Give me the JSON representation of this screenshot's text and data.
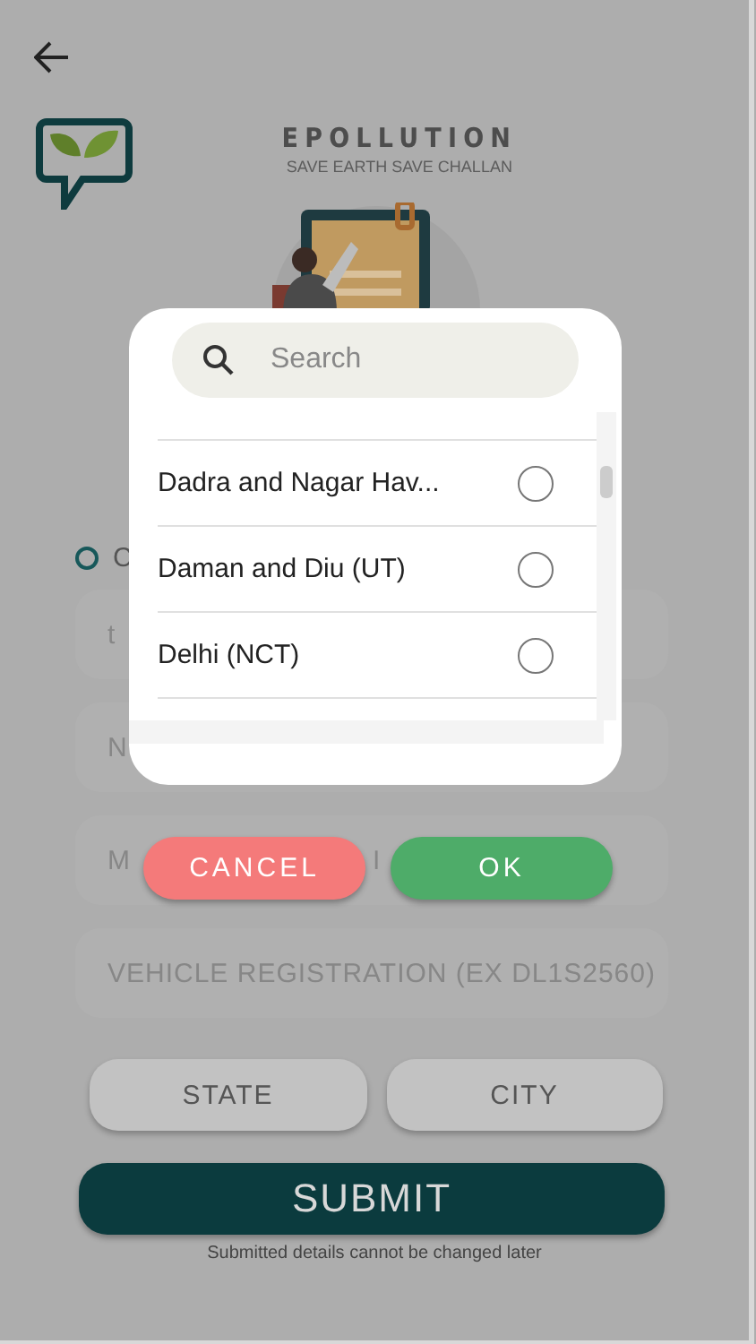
{
  "header": {
    "title": "EPOLLUTION",
    "subtitle": "SAVE EARTH SAVE CHALLAN"
  },
  "form": {
    "option_label": "C",
    "option_selected": false,
    "fields": [
      {
        "parts": [
          "t"
        ]
      },
      {
        "parts": [
          "N"
        ]
      },
      {
        "parts": [
          "M",
          "I"
        ]
      },
      {
        "parts": [
          "VEHICLE REGISTRATION (EX DL1S2560)"
        ]
      }
    ],
    "pickers": [
      "STATE",
      "CITY"
    ],
    "submit": "SUBMIT",
    "note": "Submitted details cannot be changed later"
  },
  "dialog": {
    "search": {
      "placeholder": "Search"
    },
    "items": [
      {
        "label": "Dadra and Nagar Hav...",
        "selected": false
      },
      {
        "label": "Daman and Diu (UT)",
        "selected": false
      },
      {
        "label": "Delhi (NCT)",
        "selected": false
      }
    ],
    "buttons": [
      {
        "label": "CANCEL",
        "kind": "cancel"
      },
      {
        "label": "OK",
        "kind": "ok"
      }
    ]
  }
}
